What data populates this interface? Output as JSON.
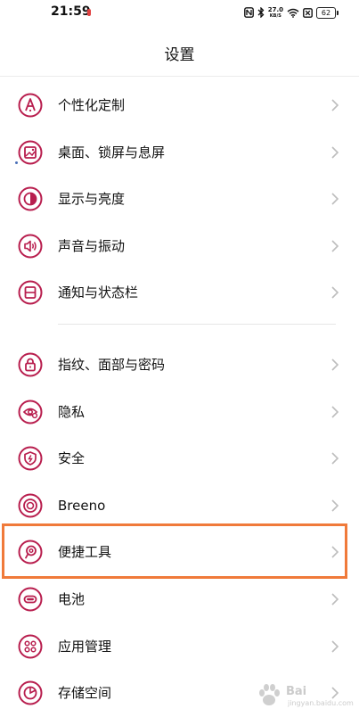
{
  "status_bar": {
    "time": "21:59",
    "notification_badge": "",
    "net_speed_value": "27.0",
    "net_speed_unit": "KB/S",
    "battery_level": "62",
    "icons": [
      "nfc-icon",
      "bluetooth-icon",
      "wifi-icon",
      "sim-icon"
    ]
  },
  "header": {
    "title": "设置"
  },
  "groups": [
    {
      "items": [
        {
          "label": "个性化定制",
          "icon": "personalization-icon"
        },
        {
          "label": "桌面、锁屏与息屏",
          "icon": "wallpaper-icon"
        },
        {
          "label": "显示与亮度",
          "icon": "display-brightness-icon"
        },
        {
          "label": "声音与振动",
          "icon": "sound-icon"
        },
        {
          "label": "通知与状态栏",
          "icon": "notification-icon"
        }
      ]
    },
    {
      "items": [
        {
          "label": "指纹、面部与密码",
          "icon": "lock-icon"
        },
        {
          "label": "隐私",
          "icon": "privacy-eye-icon"
        },
        {
          "label": "安全",
          "icon": "security-shield-icon"
        },
        {
          "label": "Breeno",
          "icon": "breeno-icon"
        },
        {
          "label": "便捷工具",
          "icon": "convenience-tools-icon"
        },
        {
          "label": "电池",
          "icon": "battery-icon"
        },
        {
          "label": "应用管理",
          "icon": "app-management-icon"
        },
        {
          "label": "存储空间",
          "icon": "storage-icon"
        }
      ]
    }
  ],
  "highlighted_item": "便捷工具",
  "watermark": {
    "text": "Bai",
    "sub": "jingyan.baidu.com"
  },
  "colors": {
    "icon_accent": "#b81e4e",
    "highlight_border": "#f07a3a",
    "chevron": "#bdbdbd"
  }
}
